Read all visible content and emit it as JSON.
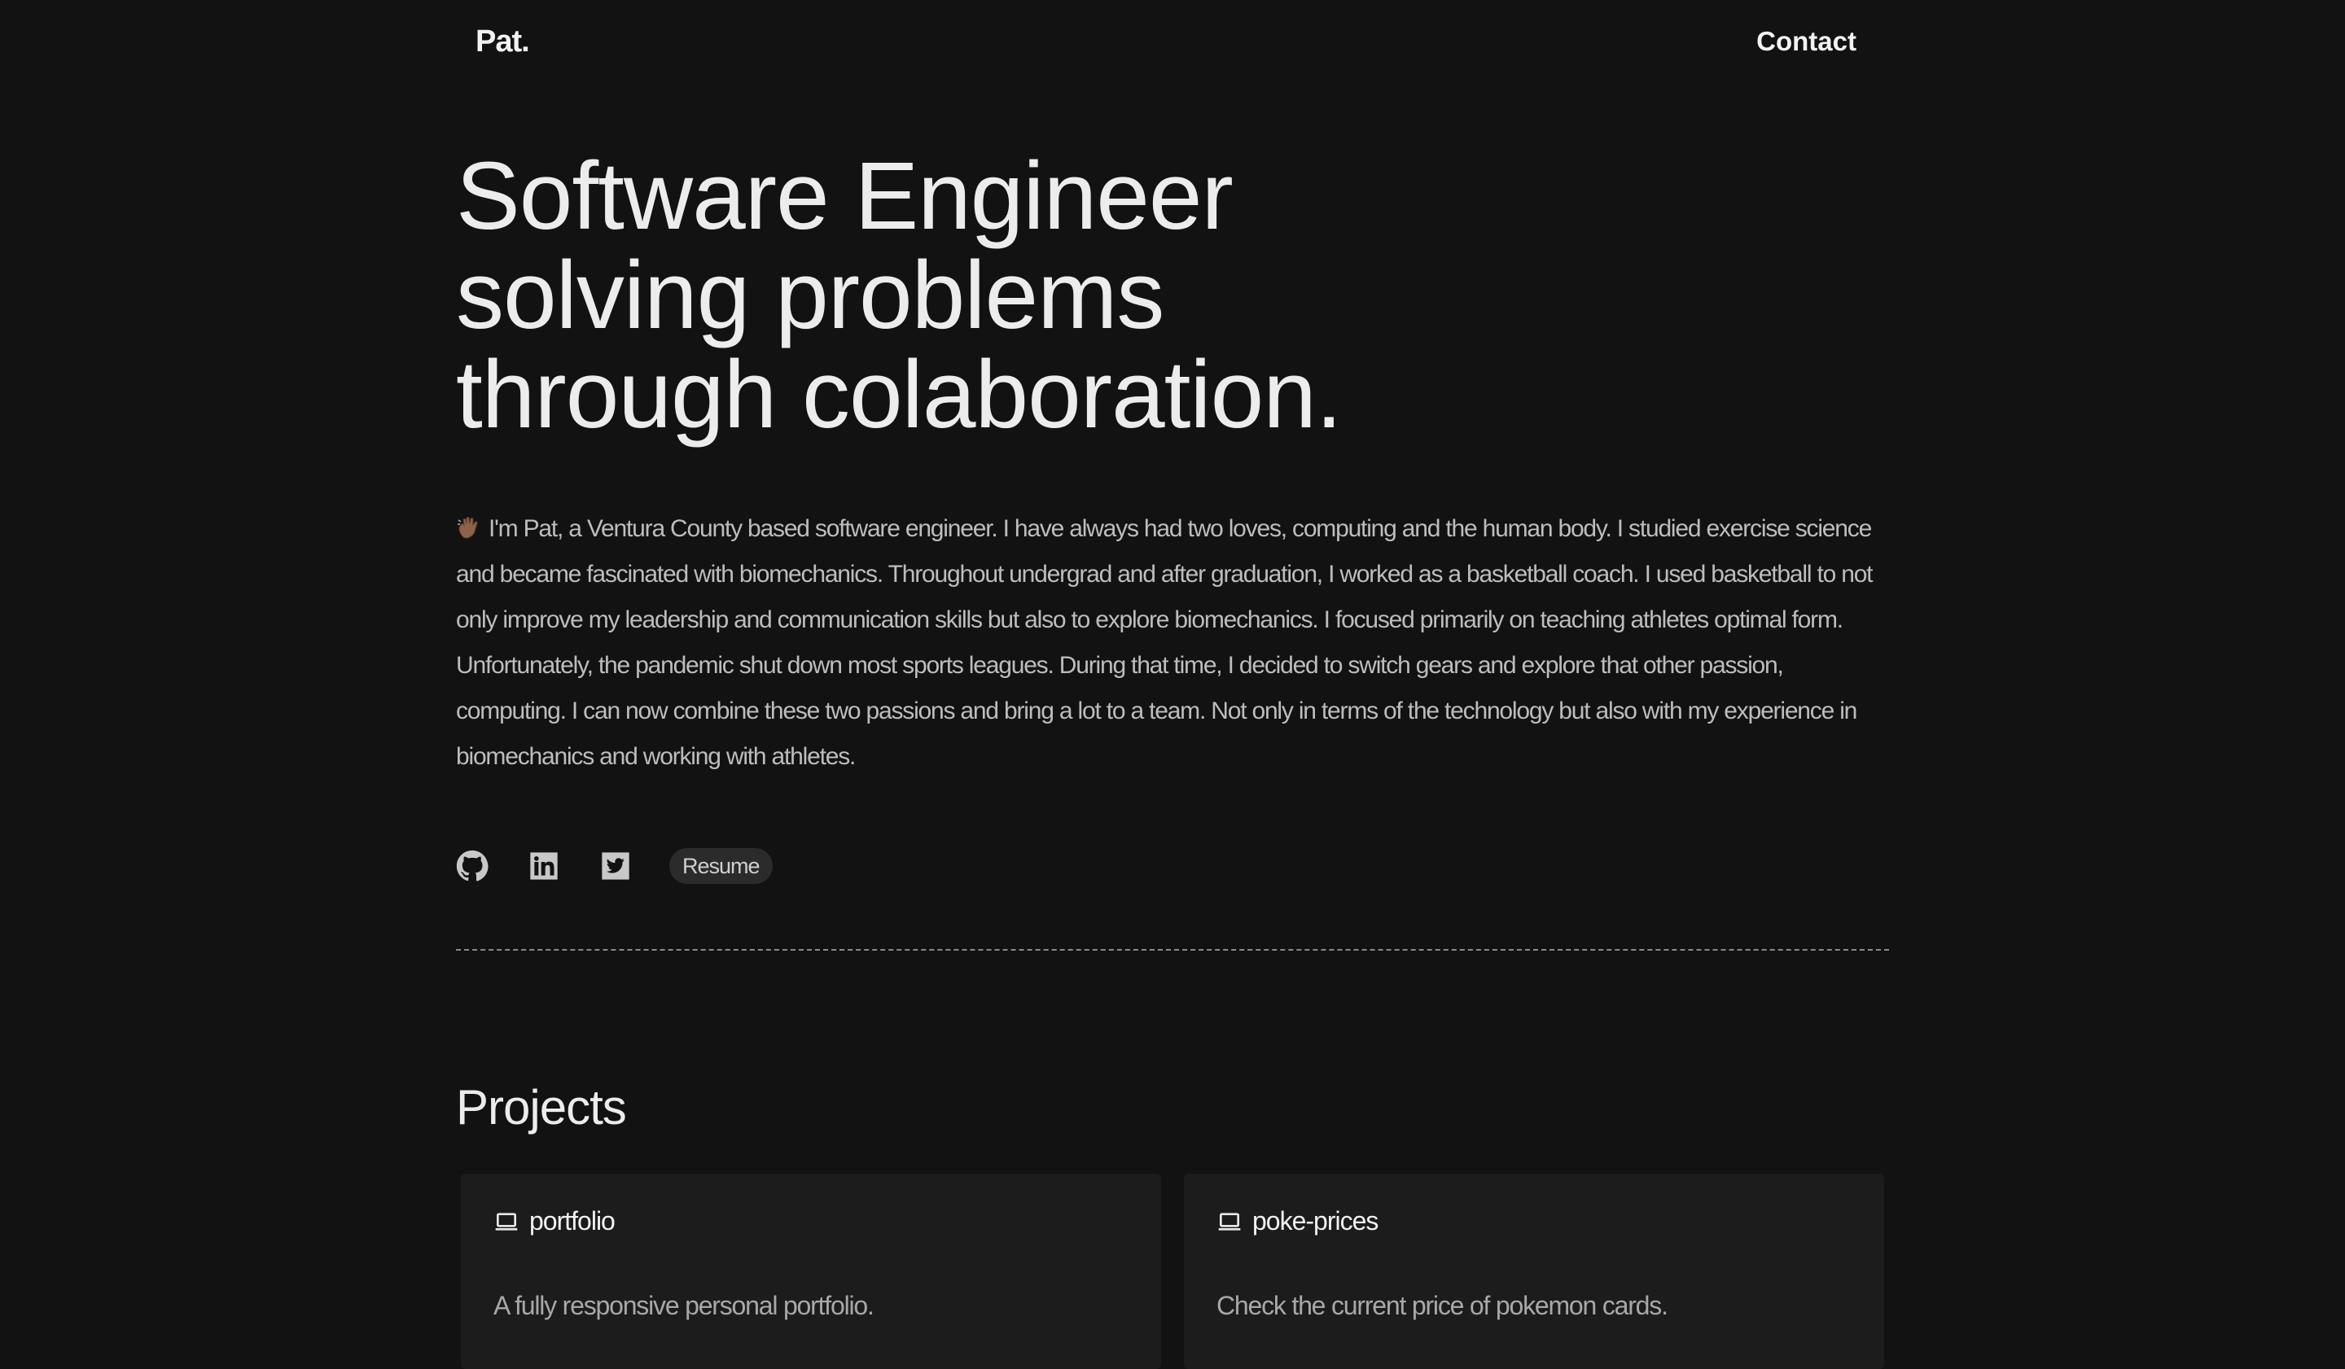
{
  "nav": {
    "logo": "Pat.",
    "contact": "Contact"
  },
  "hero": {
    "line1": "Software Engineer",
    "line2": "solving problems",
    "line3": "through colaboration."
  },
  "bio": {
    "emoji_icon": "waving-hand-icon",
    "text": "I'm Pat, a Ventura County based software engineer. I have always had two loves, computing and the human body. I studied exercise science and became fascinated with biomechanics. Throughout undergrad and after graduation, I worked as a basketball coach. I used basketball to not only improve my leadership and communication skills but also to explore biomechanics. I focused primarily on teaching athletes optimal form. Unfortunately, the pandemic shut down most sports leagues. During that time, I decided to switch gears and explore that other passion, computing. I can now combine these two passions and bring a lot to a team. Not only in terms of the technology but also with my experience in biomechanics and working with athletes."
  },
  "socials": {
    "icons": [
      "github-icon",
      "linkedin-icon",
      "twitter-icon"
    ],
    "resume_label": "Resume"
  },
  "projects": {
    "title": "Projects",
    "items": [
      {
        "icon": "laptop-icon",
        "name": "portfolio",
        "description": "A fully responsive personal portfolio."
      },
      {
        "icon": "laptop-icon",
        "name": "poke-prices",
        "description": "Check the current price of pokemon cards."
      }
    ]
  },
  "colors": {
    "background": "#121212",
    "card": "#1c1c1c",
    "text": "#ececec",
    "muted": "#bdbdbd"
  }
}
